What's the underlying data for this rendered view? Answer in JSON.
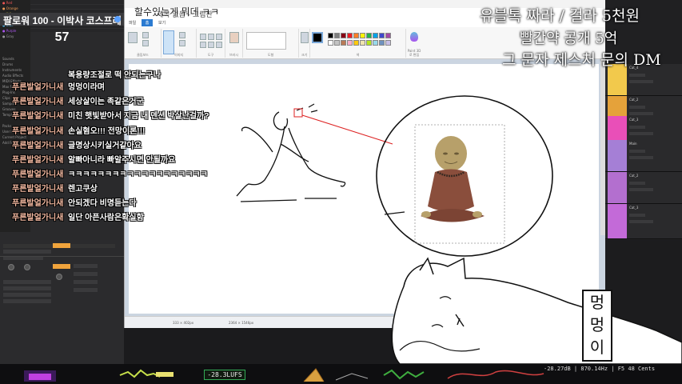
{
  "stream": {
    "follower_goal": "팔로워 100 - 이박사 코스프레",
    "follower_count": "57",
    "top_title": "할수있는게 뭐데 ㅋㅋ"
  },
  "overlay": {
    "line1": "유블톡 짜라 / 걸라 5천원",
    "line2": "빨간약 공개 5억",
    "line3": "그 문자 제스처 문의 DM"
  },
  "chat": [
    {
      "name": "",
      "msg": "복용량조절로 떡 안되는구나"
    },
    {
      "name": "푸른발얼가니새",
      "msg": "멍멍이라며"
    },
    {
      "name": "푸른발얼가니새",
      "msg": "세상살이는 족같은거군"
    },
    {
      "name": "푸른발얼가니새",
      "msg": "미친 햇빛받아서 지금 내 덴션 박살난걸까?"
    },
    {
      "name": "푸른발얼가니새",
      "msg": "손실혐오!!! 전망이론!!!"
    },
    {
      "name": "푸른발얼가니새",
      "msg": "글명상시키실거같아요"
    },
    {
      "name": "푸른발얼가니새",
      "msg": "알빠아니라 빠알주시면 안될까요"
    },
    {
      "name": "푸른발얼가니새",
      "msg": "ㅋㅋㅋㅋㅋㅋㅋㅋㅋㅋㅋㅋㅋㅋㅋㅋㅋㅋㅋ"
    },
    {
      "name": "푸른발얼가니새",
      "msg": "렌고쿠상"
    },
    {
      "name": "푸른발얼가니새",
      "msg": "안되겠다 비명듣는다"
    },
    {
      "name": "푸른발얼가니새",
      "msg": "일단 아픈사람은확실함"
    }
  ],
  "paint": {
    "title": "제목 없음 - 그림판",
    "tabs": [
      "파일",
      "홈",
      "보기"
    ],
    "groups": [
      "클립보드",
      "이미지",
      "도구",
      "브러시",
      "도형",
      "크기",
      "색",
      "Paint 3D로 편집"
    ],
    "status_position": "333 × 402px",
    "status_size": "2364 × 1546px"
  },
  "meters": {
    "lufs": "-28.3LUFS",
    "db_readout": "-28.27dB | 870.14Hz | F5   48 Cents"
  },
  "sticker": {
    "chars": [
      "멍",
      "멍",
      "이"
    ]
  }
}
